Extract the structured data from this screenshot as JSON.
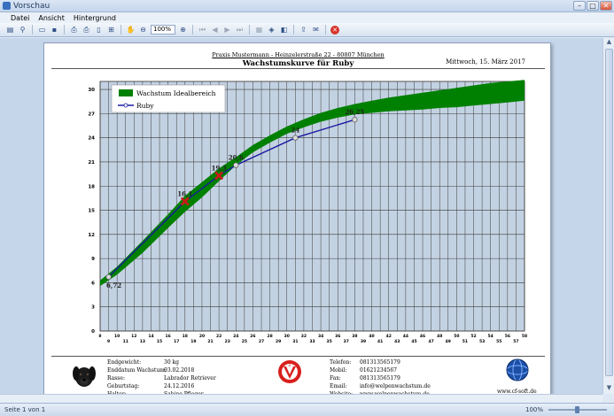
{
  "window": {
    "title": "Vorschau"
  },
  "menu": [
    "Datei",
    "Ansicht",
    "Hintergrund"
  ],
  "toolbar": {
    "zoom": "100%"
  },
  "status": {
    "page": "Seite 1 von 1",
    "zoom": "100%"
  },
  "report": {
    "practice": "Praxis Mustermann - Heinzelerstraße 22 - 80807 München",
    "title": "Wachstumskurve für Ruby",
    "date": "Mittwoch, 15. März 2017"
  },
  "chart_data": {
    "type": "area",
    "ylim": [
      0,
      31
    ],
    "xlim": [
      8,
      58
    ],
    "yticks": [
      0,
      3,
      6,
      9,
      12,
      15,
      18,
      21,
      24,
      27,
      30
    ],
    "xticks_top": [
      8,
      10,
      12,
      14,
      16,
      18,
      20,
      22,
      24,
      26,
      28,
      30,
      32,
      34,
      36,
      38,
      40,
      42,
      44,
      46,
      48,
      50,
      52,
      54,
      56,
      58
    ],
    "xticks_bottom": [
      9,
      11,
      13,
      15,
      17,
      19,
      21,
      23,
      25,
      27,
      29,
      31,
      33,
      35,
      37,
      39,
      41,
      43,
      45,
      47,
      49,
      51,
      53,
      55,
      57
    ],
    "legend": {
      "position": "top-left",
      "band_label": "Wachstum Idealbereich",
      "line_label": "Ruby"
    },
    "colors": {
      "band": "#008000",
      "line": "#1a1aa0",
      "plot_bg": "#c3d2e2",
      "marker_cross": "#cc1a1a"
    },
    "band": {
      "x": [
        8,
        10,
        13,
        16,
        18,
        20,
        22,
        24,
        26,
        28,
        30,
        32,
        34,
        36,
        38,
        40,
        42,
        44,
        46,
        48,
        50,
        52,
        54,
        56,
        58
      ],
      "lower": [
        5.6,
        7.0,
        9.7,
        12.8,
        14.8,
        16.6,
        18.6,
        20.6,
        22.2,
        23.4,
        24.5,
        25.3,
        26.0,
        26.5,
        26.9,
        27.1,
        27.3,
        27.4,
        27.5,
        27.7,
        27.8,
        28.0,
        28.2,
        28.4,
        28.6
      ],
      "upper": [
        6.3,
        8.0,
        11.2,
        14.5,
        16.8,
        18.5,
        20.2,
        21.6,
        23.1,
        24.3,
        25.4,
        26.3,
        27.1,
        27.7,
        28.2,
        28.6,
        29.0,
        29.3,
        29.6,
        29.9,
        30.2,
        30.5,
        30.8,
        31.0,
        31.2
      ]
    },
    "series": [
      {
        "name": "Ruby",
        "x": [
          9,
          18,
          22,
          24,
          31,
          38
        ],
        "y": [
          6.72,
          16.1,
          19.3,
          20.6,
          24.0,
          26.25
        ],
        "labels": [
          "6,72",
          "16,1",
          "19,3",
          "20,6",
          "24",
          "26,25"
        ],
        "markers": [
          "circle",
          "cross",
          "cross",
          "circle",
          "circle",
          "circle"
        ]
      }
    ]
  },
  "footer": {
    "left": [
      {
        "label": "Endgewicht:",
        "value": "30 kg"
      },
      {
        "label": "Enddatum Wachstum:",
        "value": "03.02.2018"
      },
      {
        "label": "Rasse:",
        "value": "Labrador Retriever"
      },
      {
        "label": "Geburtstag:",
        "value": "24.12.2016"
      },
      {
        "label": "Halter:",
        "value": "Sabine Pfleger"
      }
    ],
    "right": [
      {
        "label": "Telefon:",
        "value": "081313565179"
      },
      {
        "label": "Mobil:",
        "value": "01621234567"
      },
      {
        "label": "Fax:",
        "value": "081313565179"
      },
      {
        "label": "Email:",
        "value": "info@welpenwachstum.de"
      },
      {
        "label": "Website:",
        "value": "www.welpenwachstum.de"
      }
    ],
    "cf_site": "www.cf-soft.de"
  }
}
